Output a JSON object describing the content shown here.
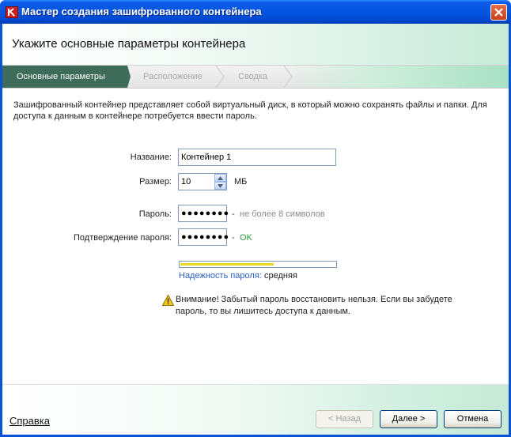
{
  "window": {
    "title": "Мастер создания зашифрованного контейнера"
  },
  "header": {
    "title": "Укажите основные параметры контейнера"
  },
  "steps": [
    {
      "label": "Основные параметры",
      "active": true
    },
    {
      "label": "Расположение",
      "active": false
    },
    {
      "label": "Сводка",
      "active": false
    }
  ],
  "description": "Зашифрованный контейнер представляет собой виртуальный диск, в который можно сохранять файлы и папки. Для доступа к данным в контейнере потребуется ввести пароль.",
  "form": {
    "name_label": "Название:",
    "name_value": "Контейнер 1",
    "size_label": "Размер:",
    "size_value": "10",
    "size_unit": "МБ",
    "password_label": "Пароль:",
    "password_value": "●●●●●●●●",
    "password_dash": "-",
    "password_hint": "не более 8 символов",
    "confirm_label": "Подтверждение пароля:",
    "confirm_value": "●●●●●●●●",
    "confirm_dash": "-",
    "confirm_status": "OK"
  },
  "strength": {
    "label": "Надежность пароля:",
    "value": "средняя",
    "level": 0.6,
    "color": "#e6d823"
  },
  "warning": {
    "icon": "warning-icon",
    "text": "Внимание! Забытый пароль восстановить нельзя. Если вы забудете пароль, то вы лишитесь доступа к данным."
  },
  "footer": {
    "help_label": "Справка",
    "back_label": "< Назад",
    "next_label": "Далее >",
    "cancel_label": "Отмена"
  },
  "colors": {
    "titlebar": "#0555e0",
    "active_step": "#3f6b5b",
    "ok": "#2b9a3e",
    "link": "#2a5fbf"
  }
}
